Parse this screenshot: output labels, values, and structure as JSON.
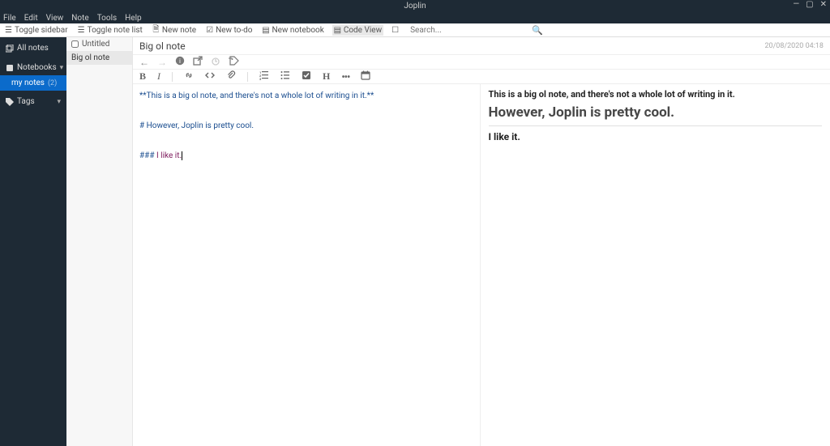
{
  "window": {
    "title": "Joplin"
  },
  "menu": [
    "File",
    "Edit",
    "View",
    "Note",
    "Tools",
    "Help"
  ],
  "toolbar": {
    "toggle_sidebar": "Toggle sidebar",
    "toggle_notelist": "Toggle note list",
    "new_note": "New note",
    "new_todo": "New to-do",
    "new_notebook": "New notebook",
    "code_view": "Code View"
  },
  "search": {
    "placeholder": "Search..."
  },
  "sidebar": {
    "all_notes": "All notes",
    "notebooks": "Notebooks",
    "tags": "Tags",
    "selected_notebook": {
      "name": "my notes",
      "count": "(2)"
    }
  },
  "notelist": [
    {
      "type": "todo",
      "title": "Untitled",
      "selected": false
    },
    {
      "type": "note",
      "title": "Big ol note",
      "selected": true
    }
  ],
  "note": {
    "title": "Big ol note",
    "timestamp": "20/08/2020 04:18"
  },
  "markdown": {
    "line1_raw": "**This is a big ol note, and there's not a whole lot of writing in it.**",
    "line2_raw": "# However, Joplin is pretty cool.",
    "line3_sym": "### ",
    "line3_text": "I like it."
  },
  "preview": {
    "bold_line": "This is a big ol note, and there's not a whole lot of writing in it.",
    "h1": "However, Joplin is pretty cool.",
    "h3": "I like it."
  }
}
